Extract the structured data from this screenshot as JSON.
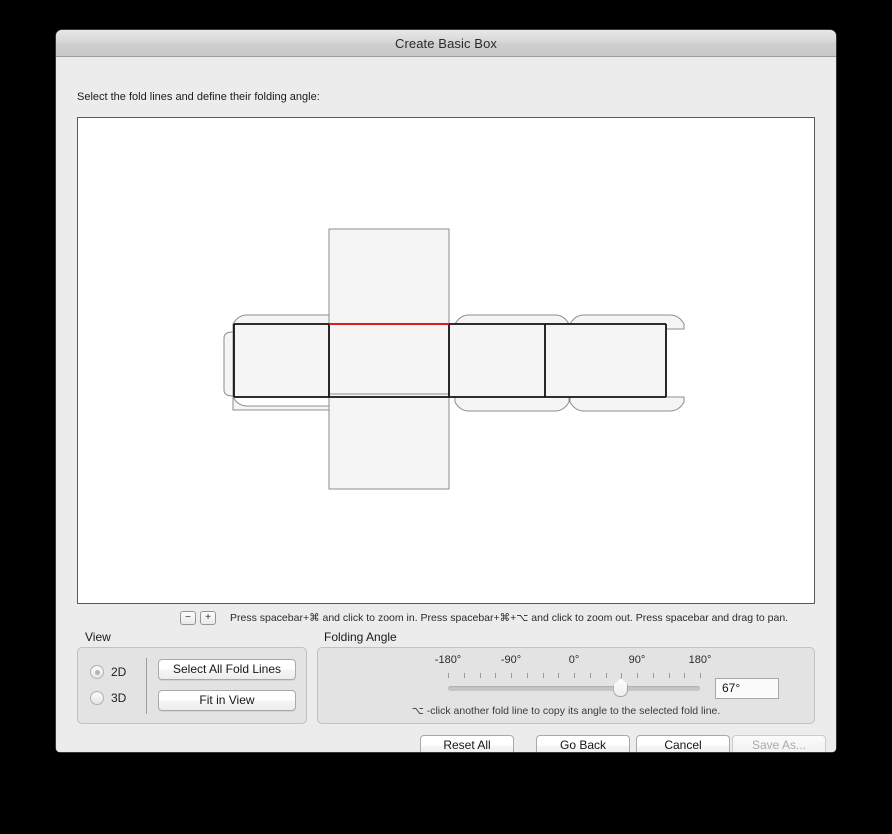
{
  "window": {
    "title": "Create Basic Box",
    "instruction": "Select the fold lines and define their folding angle:"
  },
  "canvas": {
    "zoom_out_label": "−",
    "zoom_in_label": "+",
    "hint": "Press spacebar+⌘ and click to zoom in. Press spacebar+⌘+⌥ and click to zoom out. Press spacebar and drag to pan.",
    "selected_fold_line_color": "#e01b1b",
    "panel_fill": "#f5f5f5",
    "panel_stroke": "#8d8d8d",
    "selected_stroke": "#111111"
  },
  "view_group": {
    "label": "View",
    "options": [
      {
        "label": "2D",
        "selected": true
      },
      {
        "label": "3D",
        "selected": false
      }
    ],
    "buttons": [
      {
        "label": "Select All Fold Lines"
      },
      {
        "label": "Fit in View"
      }
    ]
  },
  "folding_angle": {
    "label": "Folding Angle",
    "tick_labels": [
      "-180°",
      "-90°",
      "0°",
      "90°",
      "180°"
    ],
    "slider": {
      "min": -180,
      "max": 180,
      "value": 67,
      "tick_count": 17
    },
    "value_text": "67°",
    "hint": "⌥ -click another fold line to copy its angle to the selected fold line."
  },
  "footer": {
    "buttons": [
      {
        "name": "reset-all",
        "label": "Reset All",
        "disabled": false
      },
      {
        "name": "go-back",
        "label": "Go Back",
        "disabled": false
      },
      {
        "name": "cancel",
        "label": "Cancel",
        "disabled": false
      },
      {
        "name": "save-as",
        "label": "Save As...",
        "disabled": true
      }
    ]
  }
}
